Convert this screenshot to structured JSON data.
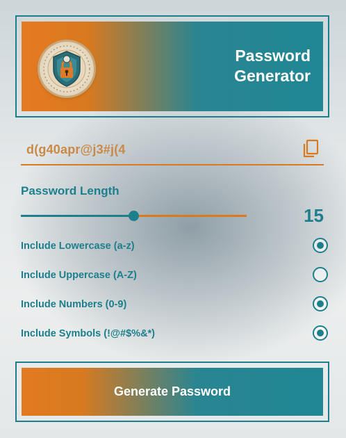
{
  "header": {
    "title_line1": "Password",
    "title_line2": "Generator",
    "logo_icon": "lock-shield-icon"
  },
  "password": {
    "value": "d(g40apr@j3#j(4",
    "copy_icon": "copy-icon"
  },
  "length": {
    "label": "Password Length",
    "value": "15",
    "slider_fraction": 0.5
  },
  "options": [
    {
      "label": "Include Lowercase (a-z)",
      "checked": true
    },
    {
      "label": "Include Uppercase (A-Z)",
      "checked": false
    },
    {
      "label": "Include Numbers (0-9)",
      "checked": true
    },
    {
      "label": "Include Symbols (!@#$%&*)",
      "checked": true
    }
  ],
  "generate": {
    "label": "Generate Password"
  },
  "colors": {
    "teal": "#1e7f8c",
    "orange": "#d97a1f"
  }
}
